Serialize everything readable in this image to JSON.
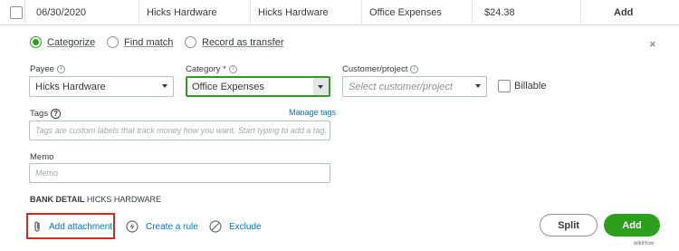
{
  "transaction_row": {
    "date": "06/30/2020",
    "description": "Hicks Hardware",
    "payee": "Hicks Hardware",
    "category": "Office Expenses",
    "amount": "$24.38",
    "action": "Add"
  },
  "mode_options": [
    {
      "label": "Categorize",
      "selected": true
    },
    {
      "label": "Find match",
      "selected": false
    },
    {
      "label": "Record as transfer",
      "selected": false
    }
  ],
  "close_glyph": "×",
  "payee": {
    "label": "Payee",
    "value": "Hicks Hardware"
  },
  "category": {
    "label": "Category *",
    "value": "Office Expenses"
  },
  "customer_project": {
    "label": "Customer/project",
    "placeholder": "Select customer/project"
  },
  "billable": {
    "label": "Billable",
    "checked": false
  },
  "tags": {
    "label": "Tags",
    "manage_link": "Manage tags",
    "placeholder": "Tags are custom labels that track money how you want. Start typing to add a tag."
  },
  "memo": {
    "label": "Memo",
    "placeholder": "Memo"
  },
  "bank_detail": {
    "heading": "BANK DETAIL",
    "value": "HICKS HARDWARE"
  },
  "actions": {
    "add_attachment": "Add attachment",
    "create_rule": "Create a rule",
    "exclude": "Exclude"
  },
  "buttons": {
    "split": "Split",
    "add": "Add"
  },
  "watermark": "wikiHow",
  "colors": {
    "brand_green": "#2ca01c",
    "link_blue": "#0077c5",
    "highlight_red": "#d52b1e",
    "text": "#393a3d",
    "border": "#babec5"
  },
  "icons": {
    "paperclip": "paperclip-icon",
    "lightning": "lightning-icon",
    "exclude": "no-entry-icon",
    "close": "close-icon",
    "info": "info-icon",
    "help": "help-icon",
    "caret": "chevron-down-icon"
  }
}
